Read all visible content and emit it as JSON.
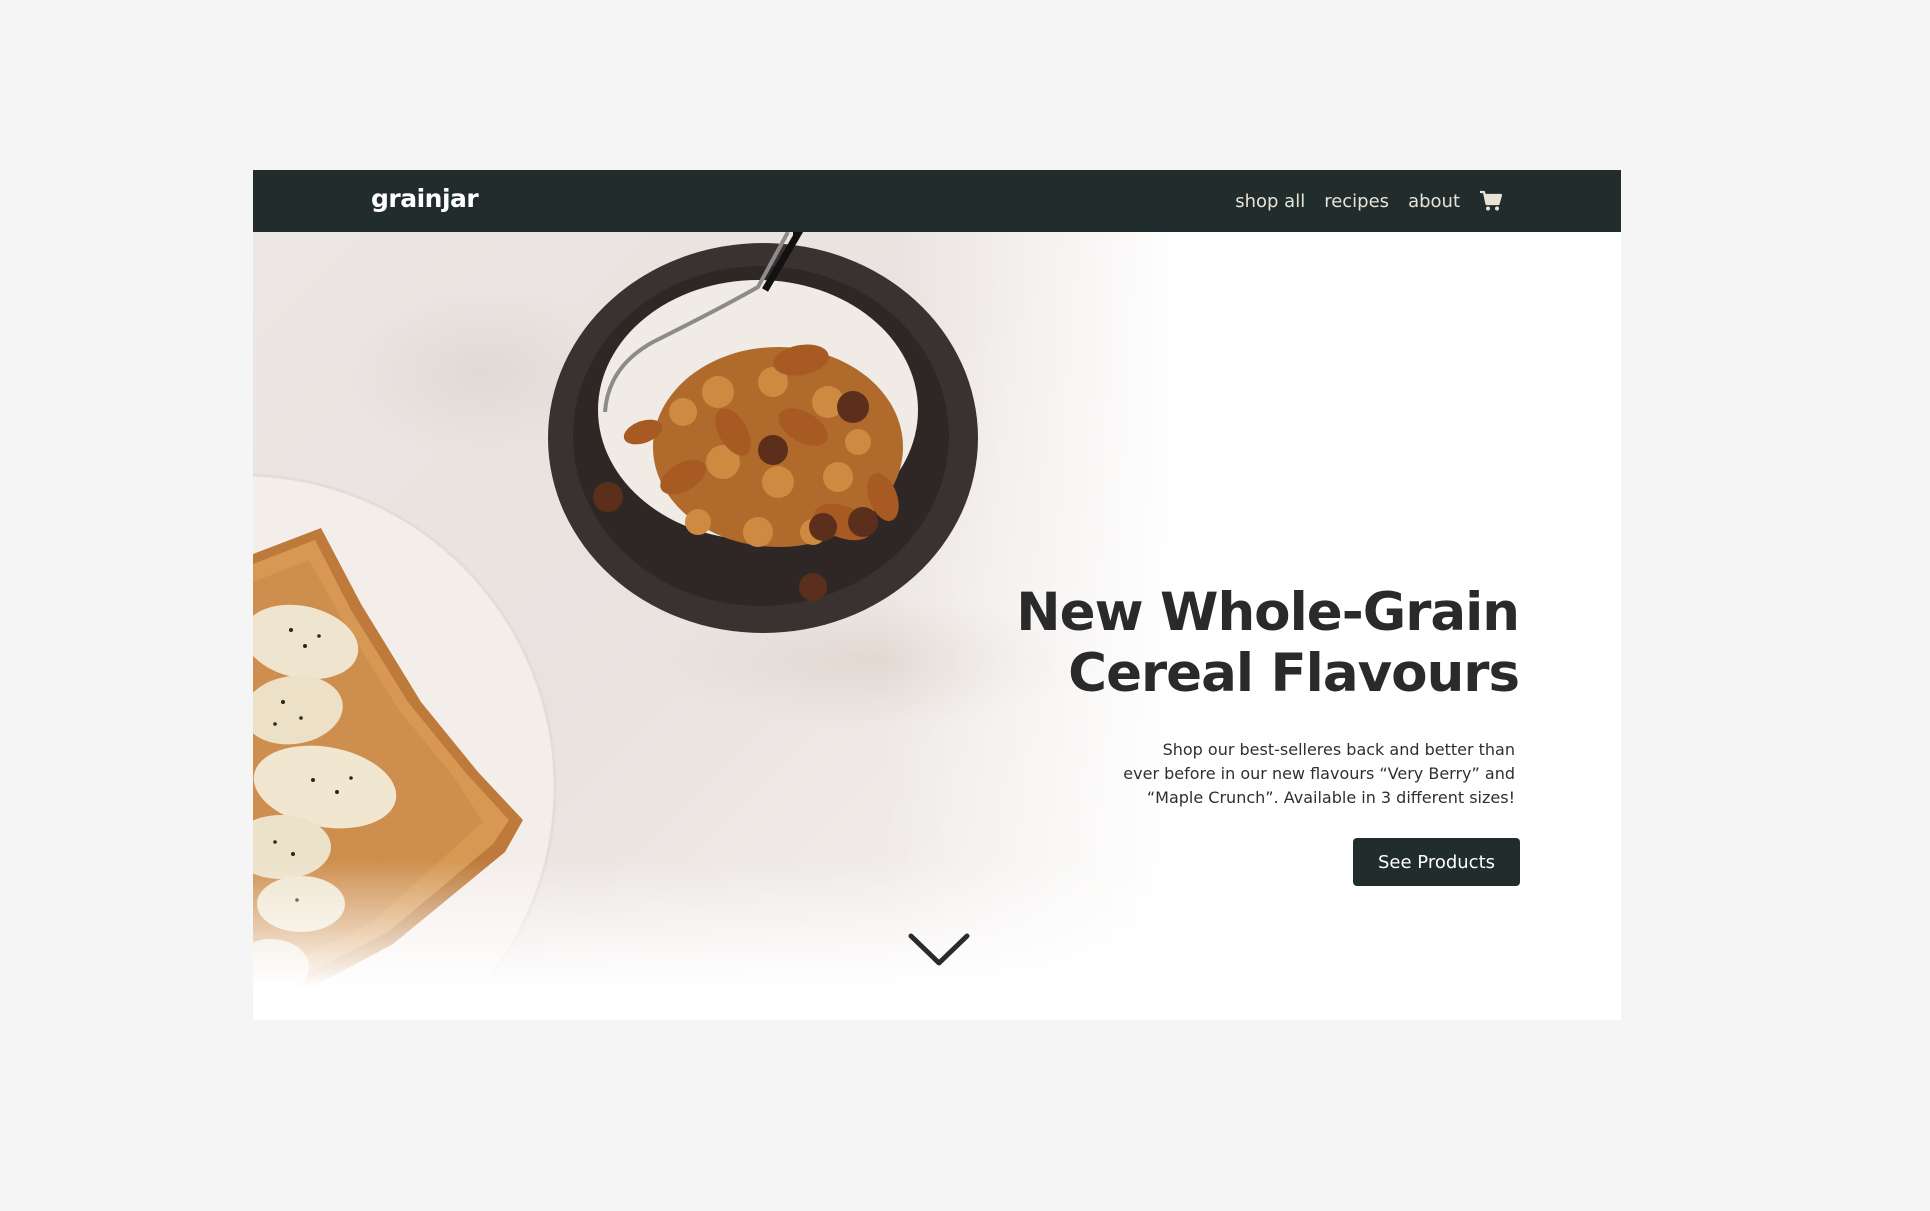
{
  "header": {
    "logo": "grainjar",
    "nav": [
      "shop all",
      "recipes",
      "about"
    ],
    "cart_icon": "cart-icon"
  },
  "hero": {
    "headline": [
      "New Whole-Grain",
      "Cereal Flavours"
    ],
    "description": [
      "Shop our best-selleres back and better than",
      "ever before in our new flavours “Very Berry” and",
      "“Maple Crunch”.  Available in 3 different sizes!"
    ],
    "cta_label": "See Products",
    "scroll_icon": "chevron-down-icon"
  },
  "colors": {
    "nav_bg": "#212c2c",
    "nav_text": "#e7e3d6",
    "headline": "#2a2a2a",
    "button_bg": "#212c2c",
    "page_bg": "#f5f5f5"
  }
}
